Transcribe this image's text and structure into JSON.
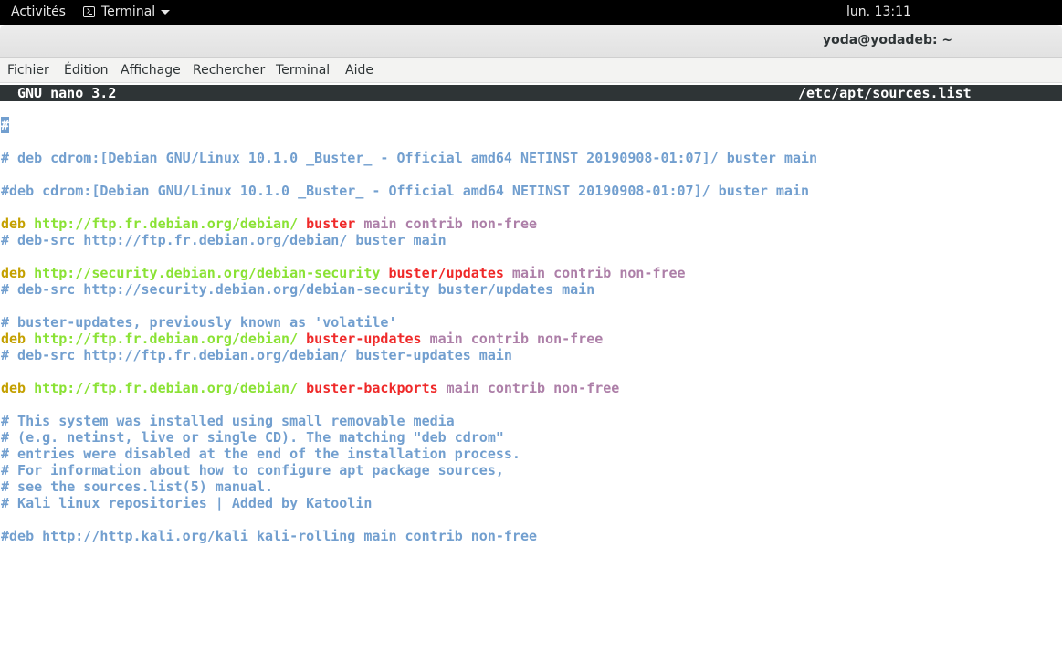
{
  "topbar": {
    "activities": "Activités",
    "app_name": "Terminal",
    "clock": "lun. 13:11"
  },
  "window": {
    "title": "yoda@yodadeb: ~"
  },
  "menubar": {
    "items": [
      "Fichier",
      "Édition",
      "Affichage",
      "Rechercher",
      "Terminal",
      "Aide"
    ]
  },
  "nano": {
    "version": "GNU nano 3.2",
    "filename": "/etc/apt/sources.list",
    "cursor_char": "#",
    "lines": {
      "l2": "# deb cdrom:[Debian GNU/Linux 10.1.0 _Buster_ - Official amd64 NETINST 20190908-01:07]/ buster main",
      "l4": "#deb cdrom:[Debian GNU/Linux 10.1.0 _Buster_ - Official amd64 NETINST 20190908-01:07]/ buster main",
      "l6": {
        "kw": "deb",
        "url": "http://ftp.fr.debian.org/debian/",
        "suite": "buster",
        "comps": "main contrib non-free"
      },
      "l7": "# deb-src http://ftp.fr.debian.org/debian/ buster main",
      "l9": {
        "kw": "deb",
        "url": "http://security.debian.org/debian-security",
        "suite": "buster/updates",
        "comps": "main contrib non-free"
      },
      "l10": "# deb-src http://security.debian.org/debian-security buster/updates main",
      "l12": "# buster-updates, previously known as 'volatile'",
      "l13": {
        "kw": "deb",
        "url": "http://ftp.fr.debian.org/debian/",
        "suite": "buster-updates",
        "comps": "main contrib non-free"
      },
      "l14": "# deb-src http://ftp.fr.debian.org/debian/ buster-updates main",
      "l16": {
        "kw": "deb",
        "url": "http://ftp.fr.debian.org/debian/",
        "suite": "buster-backports",
        "comps": "main contrib non-free"
      },
      "l18": "# This system was installed using small removable media",
      "l19": "# (e.g. netinst, live or single CD). The matching \"deb cdrom\"",
      "l20": "# entries were disabled at the end of the installation process.",
      "l21": "# For information about how to configure apt package sources,",
      "l22": "# see the sources.list(5) manual.",
      "l23": "# Kali linux repositories | Added by Katoolin",
      "l25": "#deb http://http.kali.org/kali kali-rolling main contrib non-free"
    }
  },
  "colors": {
    "comment": "#729fcf",
    "keyword": "#c4a000",
    "url": "#8ae234",
    "suite": "#ef2929",
    "components": "#ad7fa8"
  }
}
